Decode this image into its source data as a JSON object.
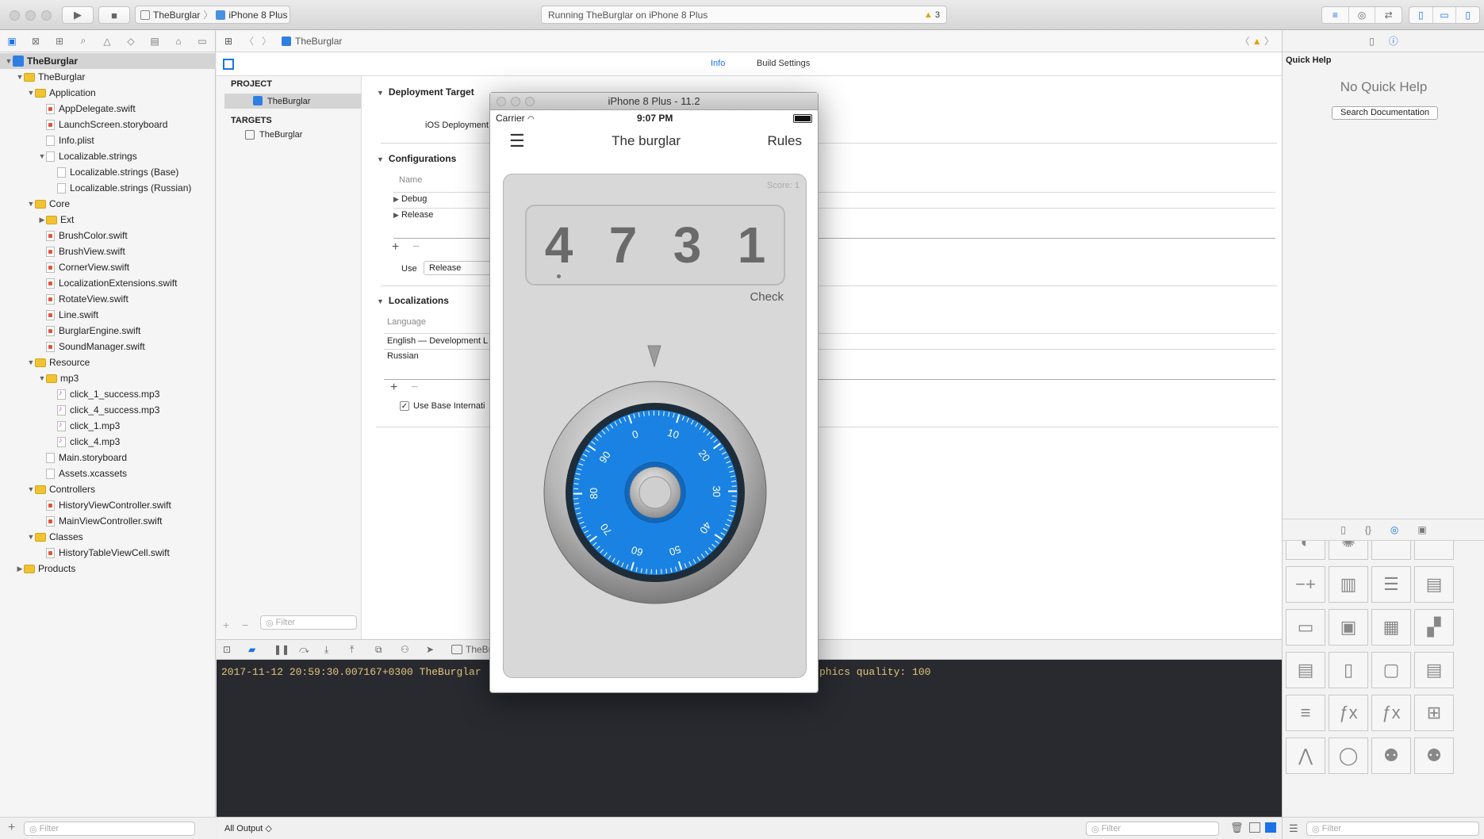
{
  "toolbar": {
    "scheme_project": "TheBurglar",
    "scheme_device": "iPhone 8 Plus",
    "activity_text": "Running TheBurglar on iPhone 8 Plus",
    "warning_count": "3"
  },
  "navigator": {
    "items": [
      {
        "label": "TheBurglar",
        "depth": 0,
        "kind": "project",
        "tri": "▼"
      },
      {
        "label": "TheBurglar",
        "depth": 1,
        "kind": "folder",
        "tri": "▼"
      },
      {
        "label": "Application",
        "depth": 2,
        "kind": "folder",
        "tri": "▼"
      },
      {
        "label": "AppDelegate.swift",
        "depth": 3,
        "kind": "swift",
        "tri": ""
      },
      {
        "label": "LaunchScreen.storyboard",
        "depth": 3,
        "kind": "swift",
        "tri": ""
      },
      {
        "label": "Info.plist",
        "depth": 3,
        "kind": "file",
        "tri": ""
      },
      {
        "label": "Localizable.strings",
        "depth": 3,
        "kind": "file",
        "tri": "▼"
      },
      {
        "label": "Localizable.strings (Base)",
        "depth": 4,
        "kind": "file",
        "tri": ""
      },
      {
        "label": "Localizable.strings (Russian)",
        "depth": 4,
        "kind": "file",
        "tri": ""
      },
      {
        "label": "Core",
        "depth": 2,
        "kind": "folder",
        "tri": "▼"
      },
      {
        "label": "Ext",
        "depth": 3,
        "kind": "folder",
        "tri": "▶"
      },
      {
        "label": "BrushColor.swift",
        "depth": 3,
        "kind": "swift",
        "tri": ""
      },
      {
        "label": "BrushView.swift",
        "depth": 3,
        "kind": "swift",
        "tri": ""
      },
      {
        "label": "CornerView.swift",
        "depth": 3,
        "kind": "swift",
        "tri": ""
      },
      {
        "label": "LocalizationExtensions.swift",
        "depth": 3,
        "kind": "swift",
        "tri": ""
      },
      {
        "label": "RotateView.swift",
        "depth": 3,
        "kind": "swift",
        "tri": ""
      },
      {
        "label": "Line.swift",
        "depth": 3,
        "kind": "swift",
        "tri": ""
      },
      {
        "label": "BurglarEngine.swift",
        "depth": 3,
        "kind": "swift",
        "tri": ""
      },
      {
        "label": "SoundManager.swift",
        "depth": 3,
        "kind": "swift",
        "tri": ""
      },
      {
        "label": "Resource",
        "depth": 2,
        "kind": "folder",
        "tri": "▼"
      },
      {
        "label": "mp3",
        "depth": 3,
        "kind": "folder",
        "tri": "▼"
      },
      {
        "label": "click_1_success.mp3",
        "depth": 4,
        "kind": "audio",
        "tri": ""
      },
      {
        "label": "click_4_success.mp3",
        "depth": 4,
        "kind": "audio",
        "tri": ""
      },
      {
        "label": "click_1.mp3",
        "depth": 4,
        "kind": "audio",
        "tri": ""
      },
      {
        "label": "click_4.mp3",
        "depth": 4,
        "kind": "audio",
        "tri": ""
      },
      {
        "label": "Main.storyboard",
        "depth": 3,
        "kind": "file",
        "tri": ""
      },
      {
        "label": "Assets.xcassets",
        "depth": 3,
        "kind": "file",
        "tri": ""
      },
      {
        "label": "Controllers",
        "depth": 2,
        "kind": "folder",
        "tri": "▼"
      },
      {
        "label": "HistoryViewController.swift",
        "depth": 3,
        "kind": "swift",
        "tri": ""
      },
      {
        "label": "MainViewController.swift",
        "depth": 3,
        "kind": "swift",
        "tri": ""
      },
      {
        "label": "Classes",
        "depth": 2,
        "kind": "folder",
        "tri": "▼"
      },
      {
        "label": "HistoryTableViewCell.swift",
        "depth": 3,
        "kind": "swift",
        "tri": ""
      },
      {
        "label": "Products",
        "depth": 1,
        "kind": "folder",
        "tri": "▶"
      }
    ],
    "filter_placeholder": "Filter"
  },
  "jumpbar": {
    "crumb": "TheBurglar"
  },
  "editor": {
    "tab_info": "Info",
    "tab_build": "Build Settings",
    "project_header": "PROJECT",
    "project_item": "TheBurglar",
    "targets_header": "TARGETS",
    "target_item": "TheBurglar",
    "filter_placeholder": "Filter",
    "deployment_title": "Deployment Target",
    "ios_deployment_label": "iOS Deployment T",
    "configurations_title": "Configurations",
    "name_col": "Name",
    "config_debug": "Debug",
    "config_release": "Release",
    "use_label": "Use",
    "use_value": "Release",
    "localizations_title": "Localizations",
    "language_col": "Language",
    "lang_english": "English — Development L",
    "lang_russian": "Russian",
    "use_base_label": "Use Base Internati"
  },
  "debug": {
    "process": "TheBu",
    "console_line": "2017-11-12 20:59:30.007167+0300 TheBurglar",
    "console_tail": "phics quality: 100",
    "output_select": "All Output ◇",
    "filter_placeholder": "Filter"
  },
  "inspector": {
    "quick_help_title": "Quick Help",
    "no_help": "No Quick Help",
    "search_doc": "Search Documentation",
    "filter_placeholder": "Filter"
  },
  "simulator": {
    "title": "iPhone 8 Plus - 11.2",
    "carrier": "Carrier",
    "time": "9:07 PM",
    "nav_title": "The burglar",
    "rules": "Rules",
    "score": "Score:  1",
    "digits": [
      "4",
      "7",
      "3",
      "1"
    ],
    "check": "Check",
    "dial_numbers": [
      "0",
      "10",
      "20",
      "30",
      "40",
      "50",
      "60",
      "70",
      "80",
      "90"
    ],
    "accent": "#1a82e2"
  }
}
